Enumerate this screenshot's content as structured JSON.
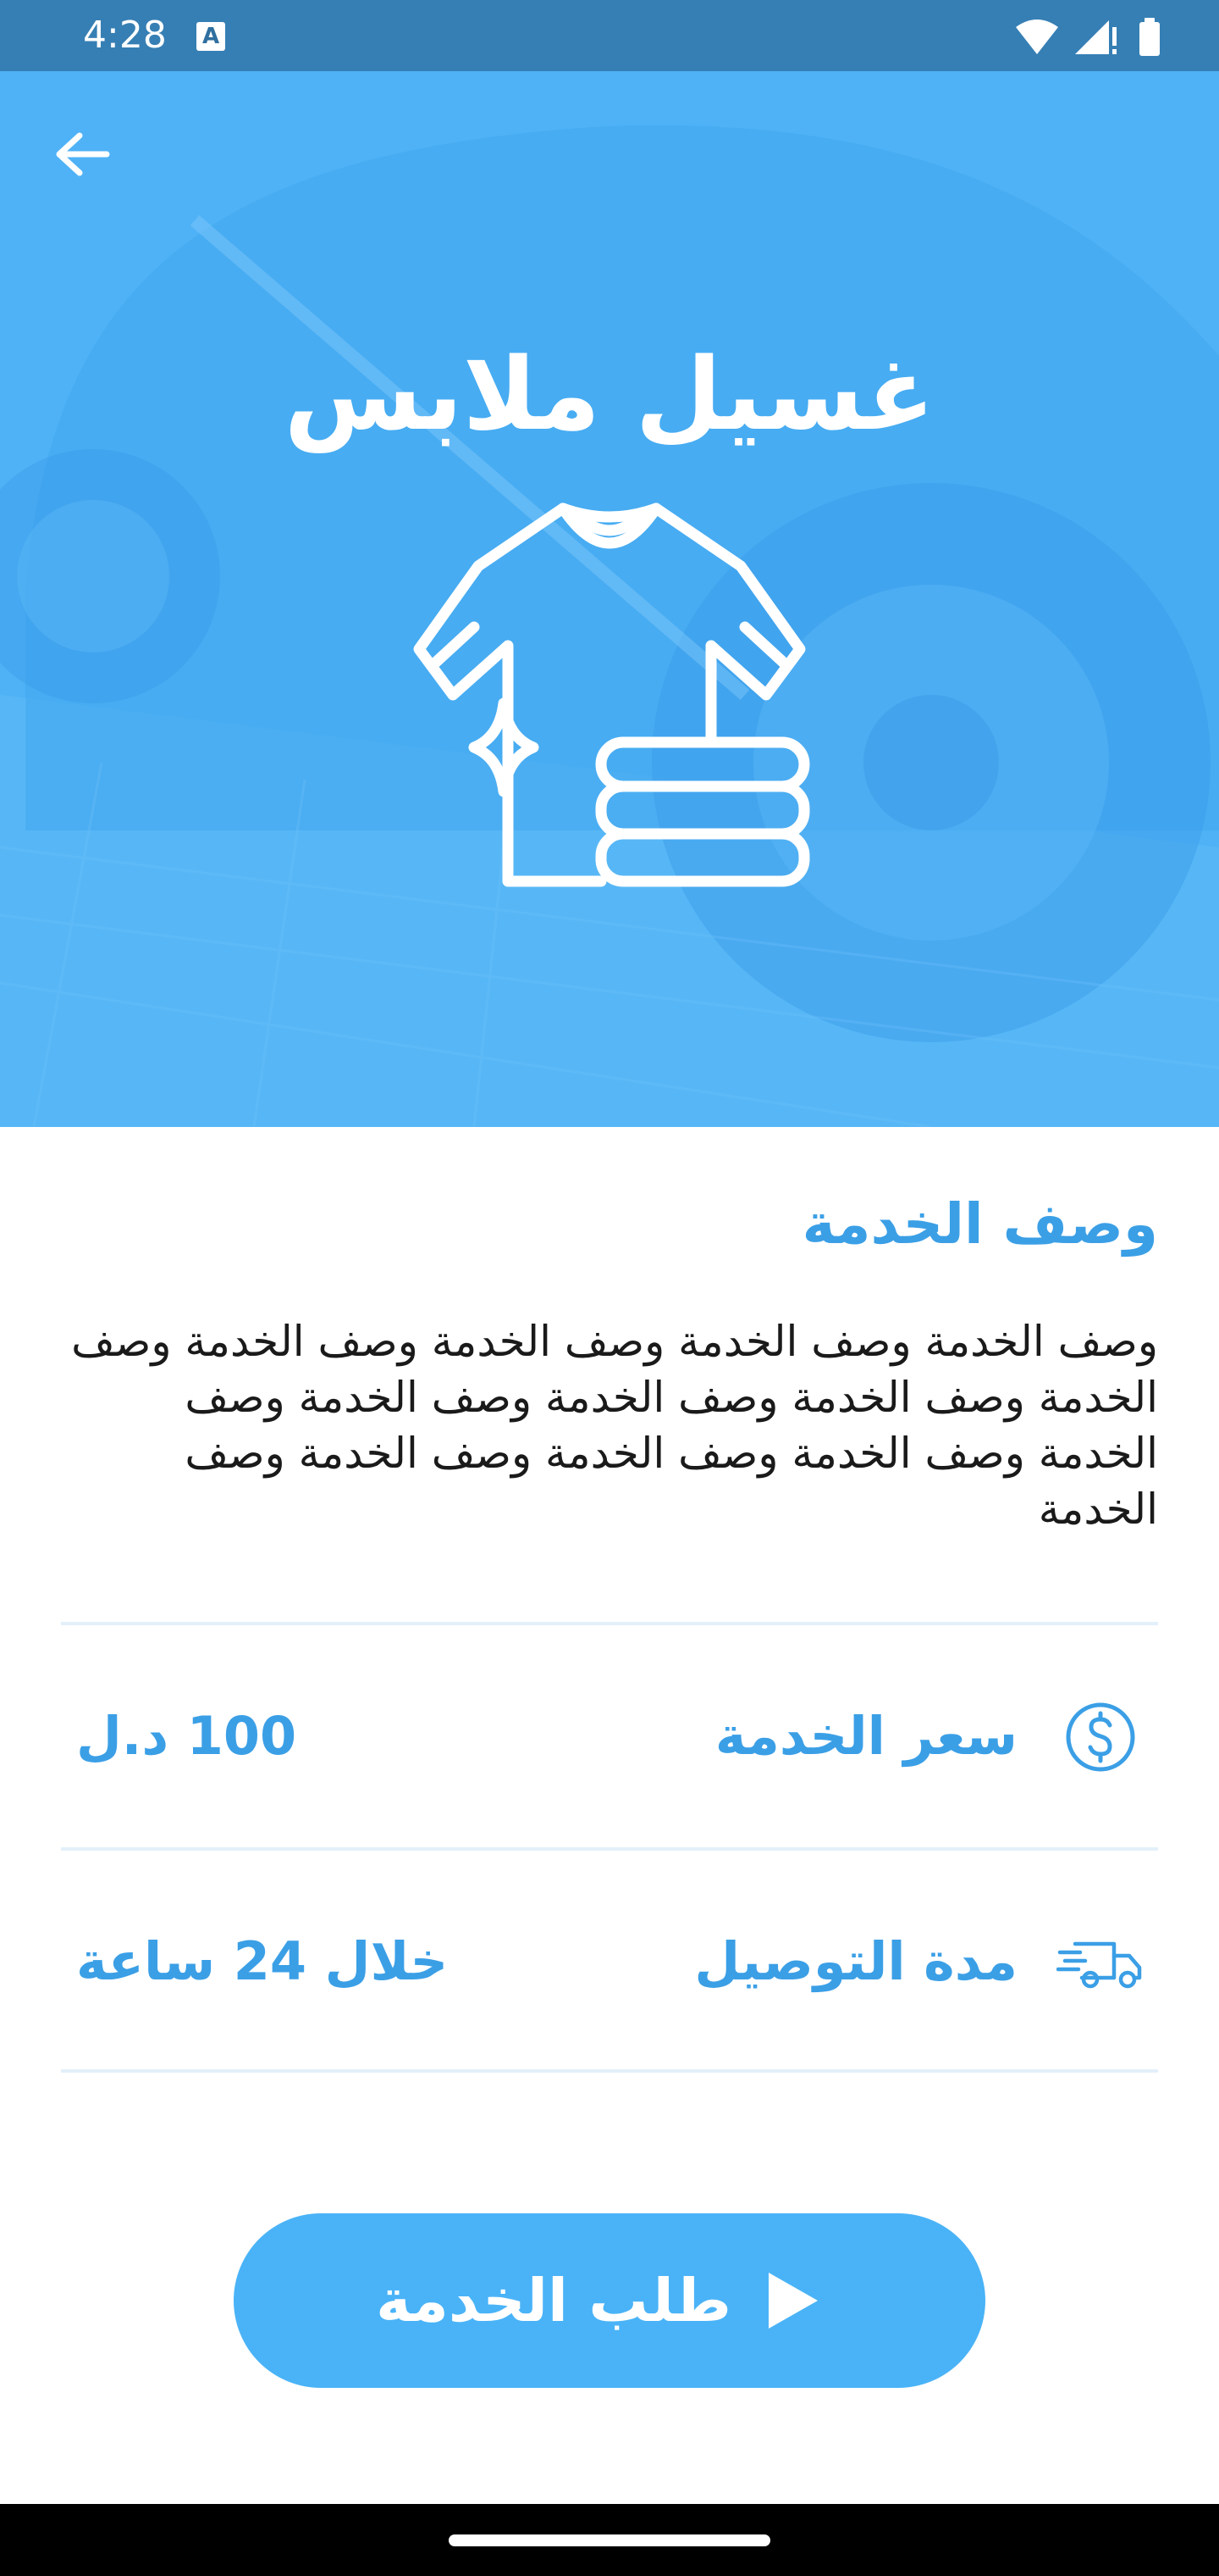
{
  "status_bar": {
    "time": "4:28"
  },
  "header": {
    "title": "غسيل ملابس"
  },
  "description": {
    "heading": "وصف الخدمة",
    "text": "وصف الخدمة وصف الخدمة وصف الخدمة وصف الخدمة وصف الخدمة وصف الخدمة وصف الخدمة وصف الخدمة وصف الخدمة وصف الخدمة وصف الخدمة وصف الخدمة وصف الخدمة"
  },
  "details": {
    "price_label": "سعر الخدمة",
    "price_value": "100 د.ل",
    "delivery_label": "مدة التوصيل",
    "delivery_value": "خلال 24 ساعة"
  },
  "actions": {
    "order_label": "طلب الخدمة"
  },
  "icons": {
    "back": "arrow-left-icon",
    "laundry": "laundry-shirt-icon",
    "price": "dollar-circle-icon",
    "delivery": "delivery-truck-icon",
    "order": "play-icon"
  },
  "colors": {
    "primary": "#3b9fe6",
    "hero_background": "#4fb2f6",
    "button": "#4ab3f7",
    "divider": "#e3f0fa"
  }
}
